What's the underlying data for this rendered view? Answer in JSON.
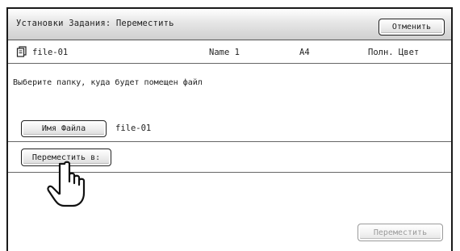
{
  "title": "Установки Задания: Переместить",
  "cancel_label": "Отменить",
  "file": {
    "name": "file-01",
    "user": "Name 1",
    "paper": "A4",
    "color_mode": "Полн. Цвет",
    "icon": "document-icon"
  },
  "instruction": "Выберите папку, куда будет помещен файл",
  "filename_button_label": "Имя Файла",
  "filename_value": "file-01",
  "move_to_label": "Переместить в:",
  "move_label": "Переместить",
  "pointer_icon": "hand-pointer-icon"
}
